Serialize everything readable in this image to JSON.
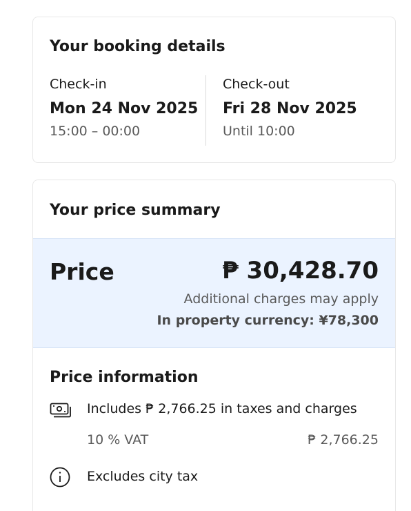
{
  "booking": {
    "title": "Your booking details",
    "checkin": {
      "label": "Check-in",
      "date": "Mon 24 Nov 2025",
      "time": "15:00 – 00:00"
    },
    "checkout": {
      "label": "Check-out",
      "date": "Fri 28 Nov 2025",
      "time": "Until 10:00"
    }
  },
  "summary": {
    "title": "Your price summary",
    "price_label": "Price",
    "price_amount": "₱ 30,428.70",
    "note": "Additional charges may apply",
    "property_currency": "In property currency: ¥78,300",
    "accent_bg": "#ebf3ff"
  },
  "price_info": {
    "title": "Price information",
    "taxes_text": "Includes ₱ 2,766.25 in taxes and charges",
    "taxes_icon": "money-icon",
    "vat_label": "10 % VAT",
    "vat_amount": "₱ 2,766.25",
    "city_tax_text": "Excludes city tax",
    "city_tax_icon": "info-icon"
  }
}
